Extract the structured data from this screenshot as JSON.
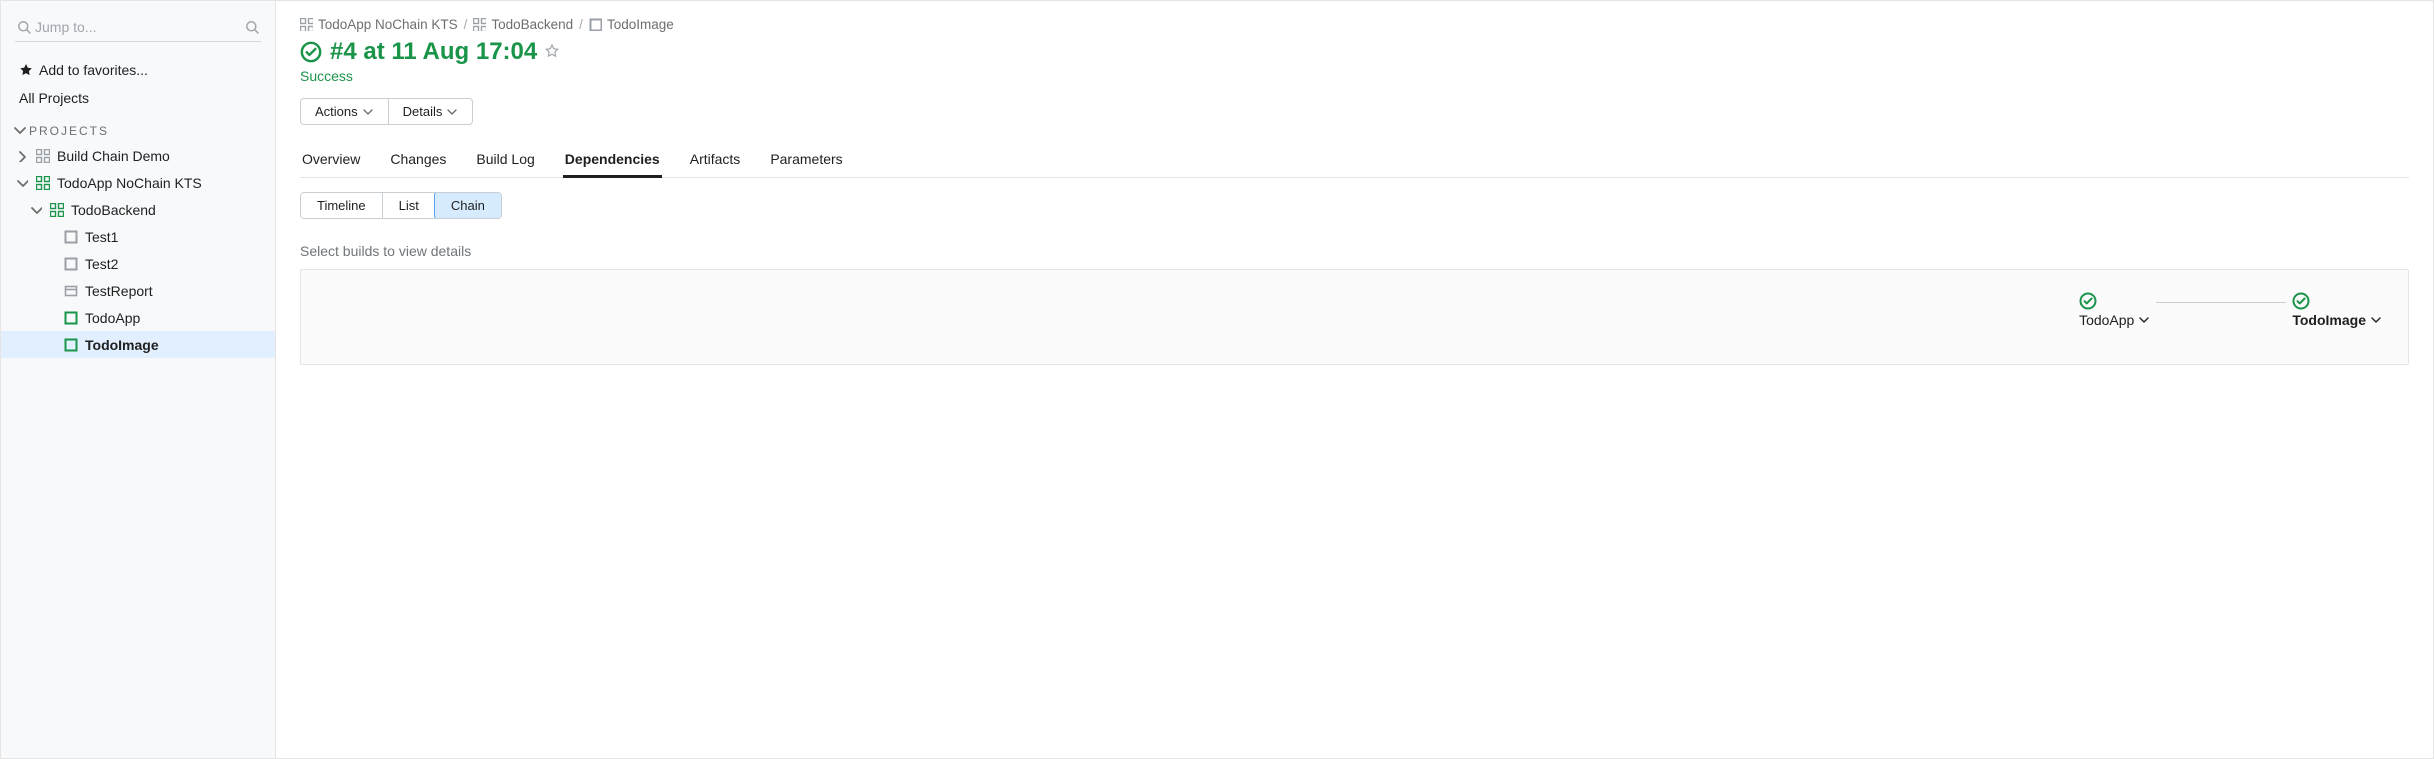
{
  "colors": {
    "success": "#1a9449",
    "accent": "#5aa6ed"
  },
  "sidebar": {
    "search_placeholder": "Jump to...",
    "favorites_label": "Add to favorites...",
    "all_projects_label": "All Projects",
    "section_title": "PROJECTS",
    "tree": [
      {
        "label": "Build Chain Demo",
        "icon": "workflow-grey",
        "depth": 0,
        "expanded": false,
        "active": false,
        "bold": false,
        "hasChildren": true
      },
      {
        "label": "TodoApp NoChain KTS",
        "icon": "workflow-green",
        "depth": 0,
        "expanded": true,
        "active": false,
        "bold": false,
        "hasChildren": true
      },
      {
        "label": "TodoBackend",
        "icon": "workflow-green",
        "depth": 1,
        "expanded": true,
        "active": false,
        "bold": false,
        "hasChildren": true
      },
      {
        "label": "Test1",
        "icon": "square-grey",
        "depth": 2,
        "expanded": false,
        "active": false,
        "bold": false,
        "hasChildren": false
      },
      {
        "label": "Test2",
        "icon": "square-grey",
        "depth": 2,
        "expanded": false,
        "active": false,
        "bold": false,
        "hasChildren": false
      },
      {
        "label": "TestReport",
        "icon": "report-grey",
        "depth": 2,
        "expanded": false,
        "active": false,
        "bold": false,
        "hasChildren": false
      },
      {
        "label": "TodoApp",
        "icon": "square-green",
        "depth": 2,
        "expanded": false,
        "active": false,
        "bold": false,
        "hasChildren": false
      },
      {
        "label": "TodoImage",
        "icon": "square-green",
        "depth": 2,
        "expanded": false,
        "active": true,
        "bold": true,
        "hasChildren": false
      }
    ]
  },
  "main": {
    "breadcrumb": [
      {
        "label": "TodoApp NoChain KTS",
        "icon": "workflow-grey"
      },
      {
        "label": "TodoBackend",
        "icon": "workflow-grey"
      },
      {
        "label": "TodoImage",
        "icon": "square-grey"
      }
    ],
    "title": "#4 at 11 Aug 17:04",
    "status": "Success",
    "buttons": {
      "actions": "Actions",
      "details": "Details"
    },
    "tabs": [
      {
        "label": "Overview",
        "active": false
      },
      {
        "label": "Changes",
        "active": false
      },
      {
        "label": "Build Log",
        "active": false
      },
      {
        "label": "Dependencies",
        "active": true
      },
      {
        "label": "Artifacts",
        "active": false
      },
      {
        "label": "Parameters",
        "active": false
      }
    ],
    "view_switch": [
      {
        "label": "Timeline",
        "active": false
      },
      {
        "label": "List",
        "active": false
      },
      {
        "label": "Chain",
        "active": true
      }
    ],
    "hint": "Select builds to view details",
    "chain": [
      {
        "label": "TodoApp",
        "bold": false
      },
      {
        "label": "TodoImage",
        "bold": true
      }
    ]
  }
}
